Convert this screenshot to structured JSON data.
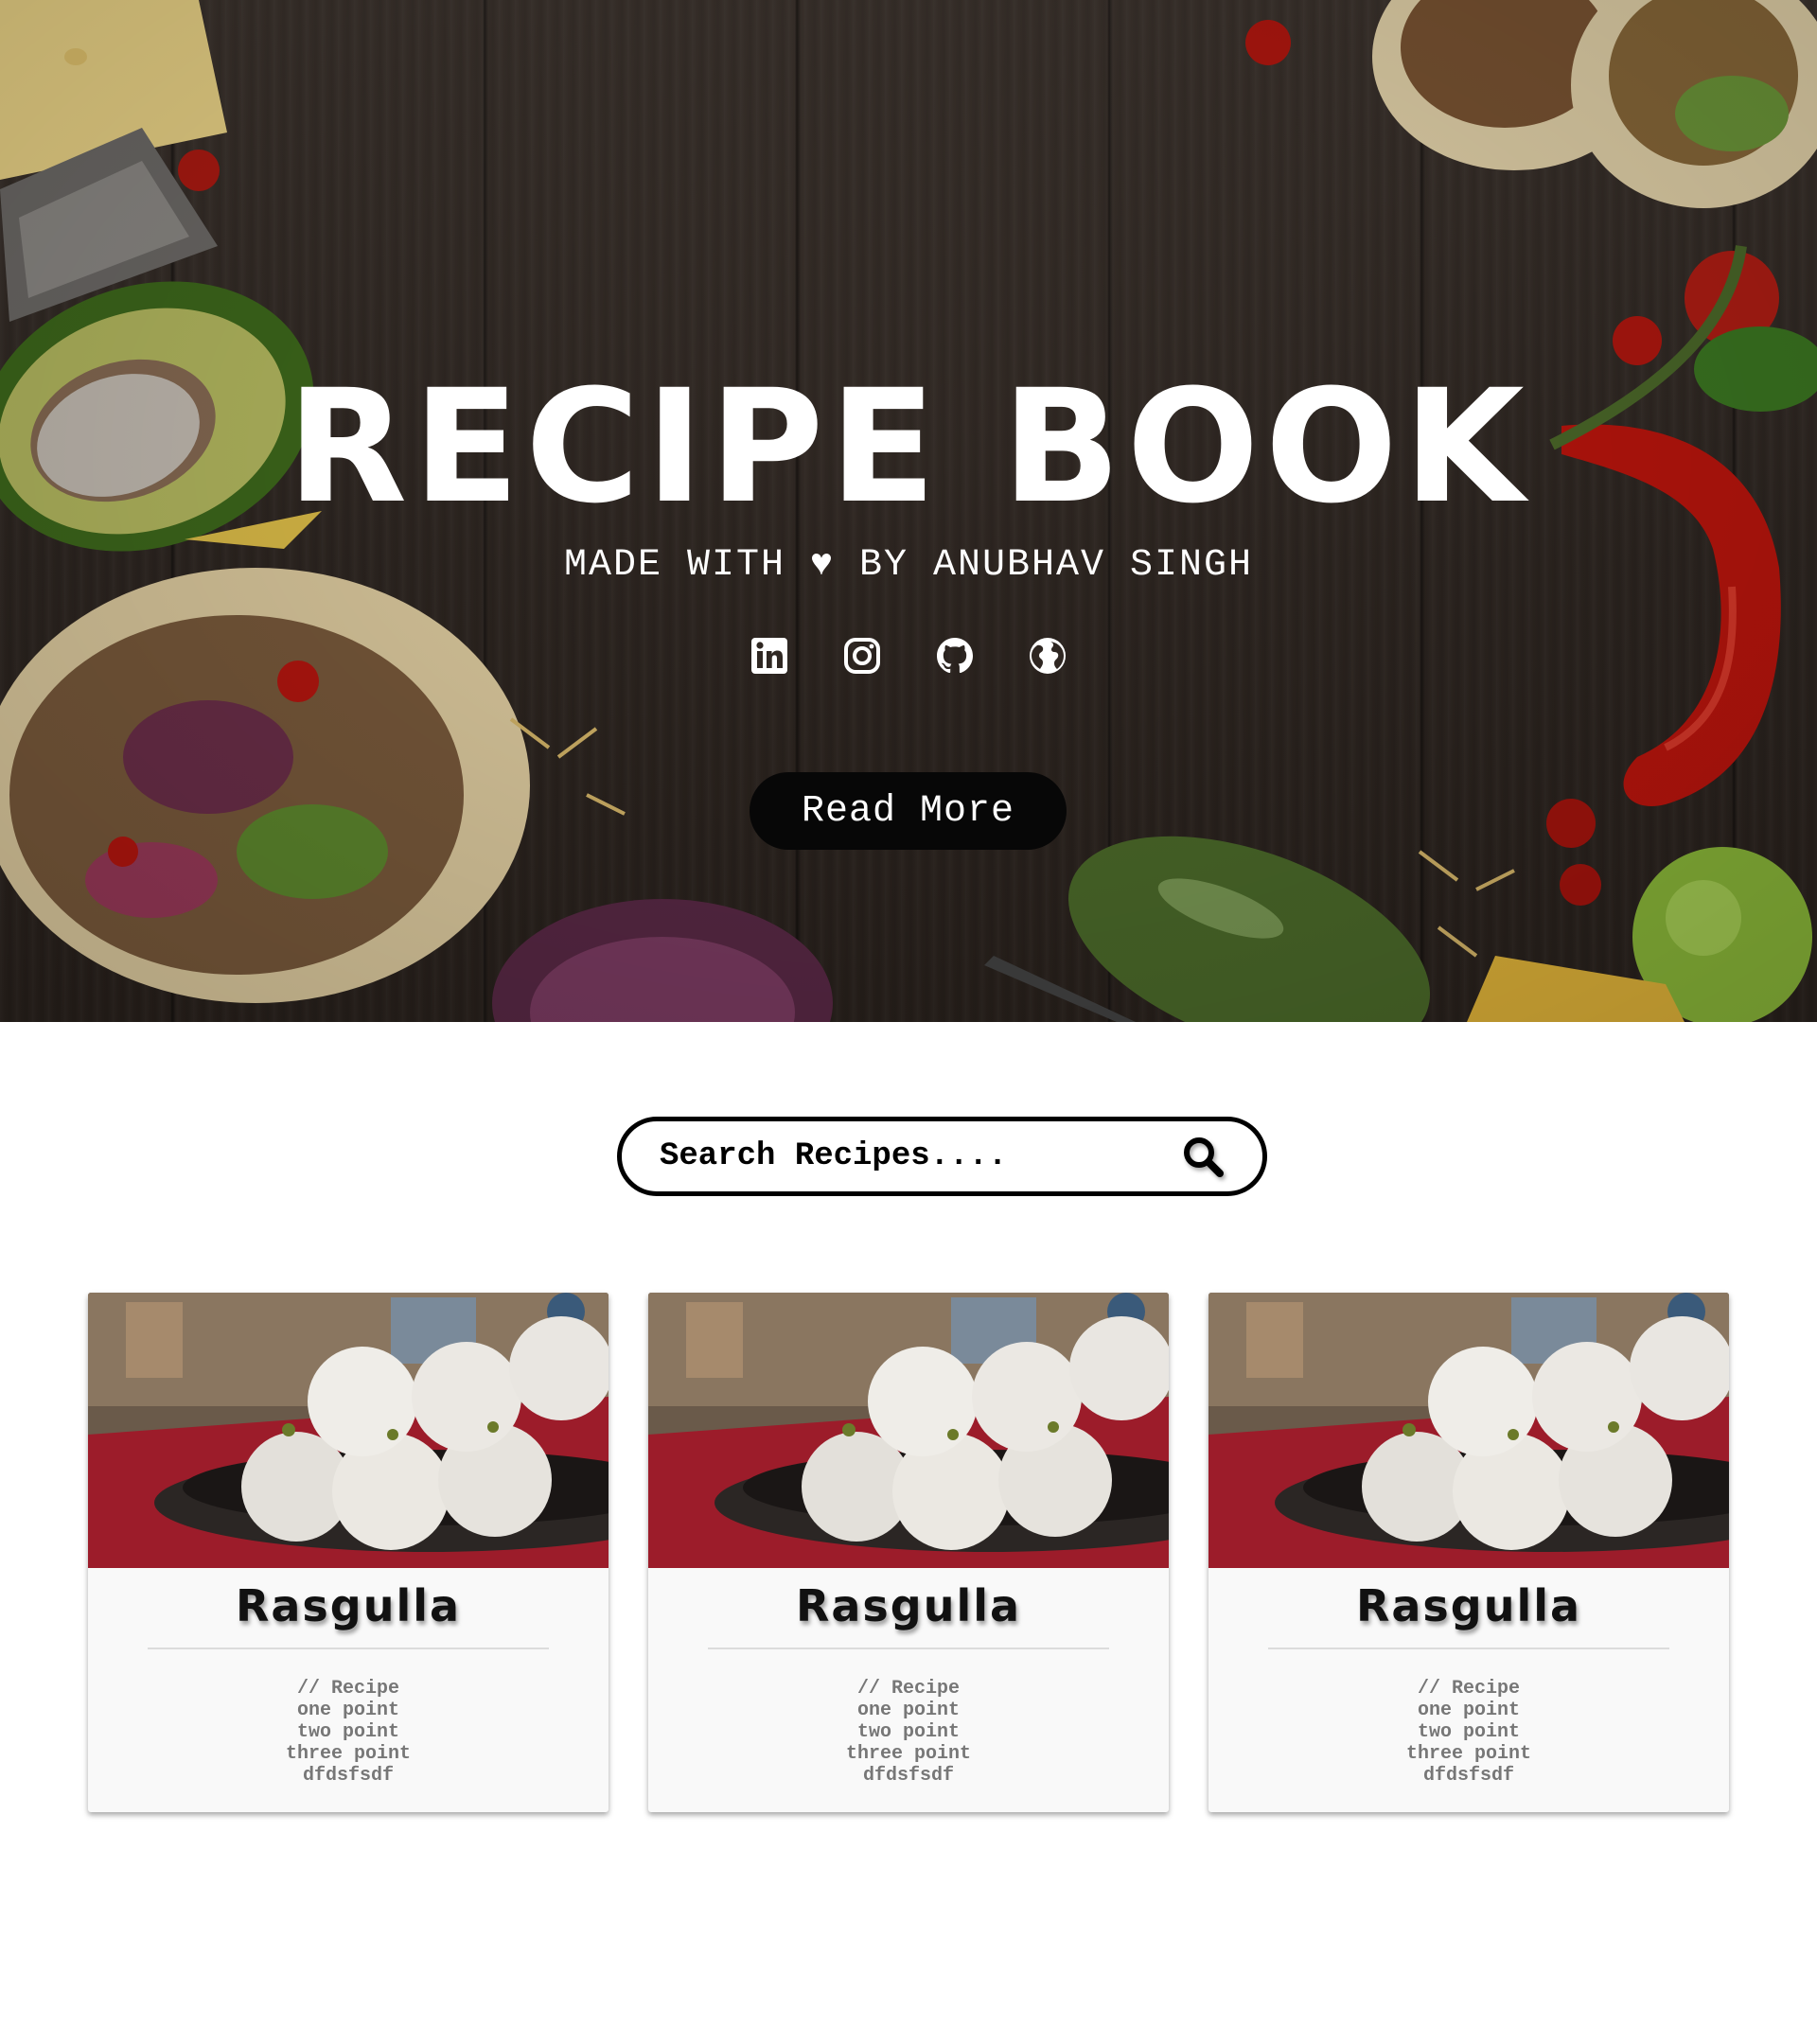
{
  "hero": {
    "title": "RECIPE BOOK",
    "subtitle": "MADE WITH ♥ BY ANUBHAV SINGH",
    "read_more_label": "Read More",
    "socials": [
      {
        "icon": "linkedin-icon"
      },
      {
        "icon": "instagram-icon"
      },
      {
        "icon": "github-icon"
      },
      {
        "icon": "globe-icon"
      }
    ]
  },
  "search": {
    "placeholder": "Search Recipes....",
    "icon": "search-icon"
  },
  "cards": [
    {
      "title": "Rasgulla",
      "body": "// Recipe\none point\ntwo point\nthree point\ndfdsfsdf"
    },
    {
      "title": "Rasgulla",
      "body": "// Recipe\none point\ntwo point\nthree point\ndfdsfsdf"
    },
    {
      "title": "Rasgulla",
      "body": "// Recipe\none point\ntwo point\nthree point\ndfdsfsdf"
    }
  ],
  "colors": {
    "hero_wood": "#3d342e",
    "button_bg": "#070707",
    "text_light": "#ffffff",
    "card_bg": "#f9f9f9",
    "card_text": "#777777"
  }
}
